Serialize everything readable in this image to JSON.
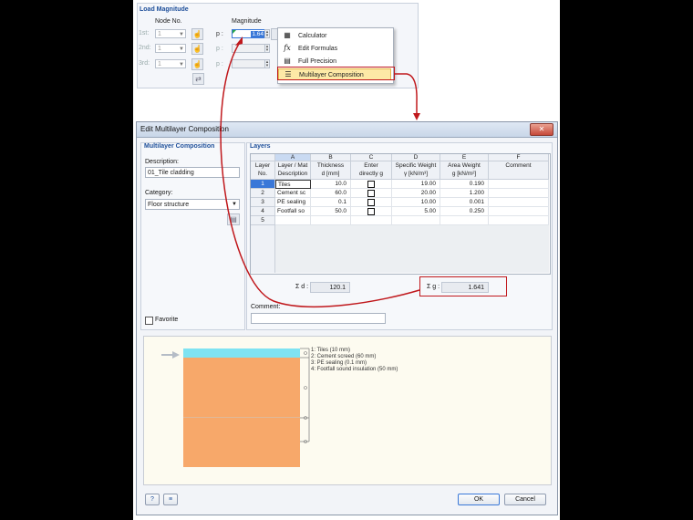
{
  "load_magnitude": {
    "title": "Load Magnitude",
    "col_node": "Node No.",
    "col_magnitude": "Magnitude",
    "rows": [
      {
        "label": "1st:",
        "node": "1",
        "p_label": "p :",
        "value": "1.64"
      },
      {
        "label": "2nd:",
        "node": "1",
        "p_label": "p :",
        "value": ""
      },
      {
        "label": "3rd:",
        "node": "1",
        "p_label": "p :",
        "value": ""
      }
    ],
    "context_menu": [
      {
        "label": "Calculator",
        "icon": "calculator-icon"
      },
      {
        "label": "Edit Formulas",
        "icon": "function-icon"
      },
      {
        "label": "Full Precision",
        "icon": "precision-icon"
      },
      {
        "label": "Multilayer Composition",
        "icon": "multilayer-icon"
      }
    ]
  },
  "dialog": {
    "title": "Edit Multilayer Composition",
    "left_pane_title": "Multilayer Composition",
    "description_label": "Description:",
    "description_value": "01_Tile cladding",
    "category_label": "Category:",
    "category_value": "Floor structure",
    "favorite_label": "Favorite",
    "layers_title": "Layers",
    "columns": [
      {
        "letter": "",
        "line1": "Layer",
        "line2": "No."
      },
      {
        "letter": "A",
        "line1": "Layer / Mat",
        "line2": "Description"
      },
      {
        "letter": "B",
        "line1": "Thickness",
        "line2": "d [mm]"
      },
      {
        "letter": "C",
        "line1": "Enter",
        "line2": "directly g"
      },
      {
        "letter": "D",
        "line1": "Specific Weight",
        "line2": "γ [kN/m³]"
      },
      {
        "letter": "E",
        "line1": "Area Weight",
        "line2": "g [kN/m²]"
      },
      {
        "letter": "F",
        "line1": "",
        "line2": "Comment"
      }
    ],
    "rows": [
      {
        "no": "1",
        "desc": "Tiles",
        "d": "10.0",
        "gamma": "19.00",
        "g": "0.190"
      },
      {
        "no": "2",
        "desc": "Cement sc",
        "d": "60.0",
        "gamma": "20.00",
        "g": "1.200"
      },
      {
        "no": "3",
        "desc": "PE sealing",
        "d": "0.1",
        "gamma": "10.00",
        "g": "0.001"
      },
      {
        "no": "4",
        "desc": "Footfall so",
        "d": "50.0",
        "gamma": "5.00",
        "g": "0.250"
      },
      {
        "no": "5",
        "desc": "",
        "d": "",
        "gamma": "",
        "g": ""
      }
    ],
    "sum_d_label": "Σ d :",
    "sum_d_value": "120.1",
    "sum_g_label": "Σ g :",
    "sum_g_value": "1.641",
    "comment_label": "Comment:",
    "legend": [
      "1: Tiles (10 mm)",
      "2: Cement screed (60 mm)",
      "3: PE sealing (0.1 mm)",
      "4: Footfall sound insulation (50 mm)"
    ],
    "ok_label": "OK",
    "cancel_label": "Cancel",
    "close_label": "✕"
  },
  "colors": {
    "tile_layer": "#7fe3f2",
    "screed_layer": "#f7a86a",
    "highlight_red": "#c0181c",
    "accent_blue": "#1e4f9a"
  }
}
